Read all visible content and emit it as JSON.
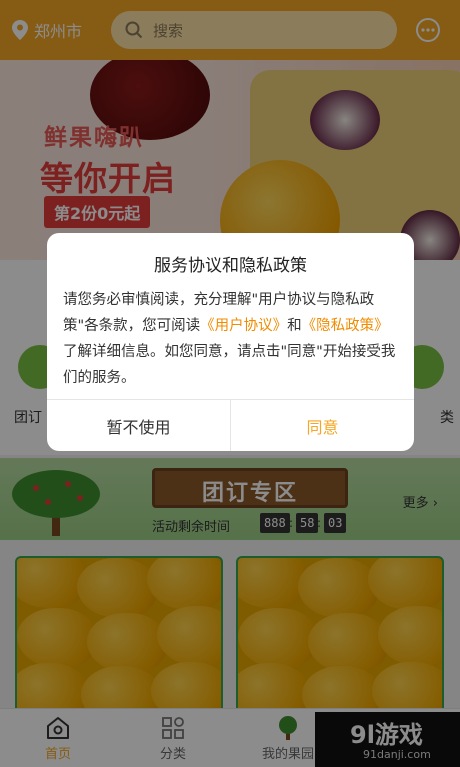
{
  "header": {
    "city": "郑州市",
    "search_placeholder": "搜索"
  },
  "banner": {
    "line1": "鲜果嗨趴",
    "line2": "等你开启",
    "promo": "第2份0元起"
  },
  "categories": {
    "left_label": "团订",
    "right_label": "类"
  },
  "group_zone": {
    "title": "团订专区",
    "countdown_label": "活动剩余时间",
    "countdown": [
      "888",
      "58",
      "03"
    ],
    "more": "更多"
  },
  "tabbar": {
    "tabs": [
      {
        "label": "首页"
      },
      {
        "label": "分类"
      },
      {
        "label": "我的果园"
      }
    ]
  },
  "watermark": {
    "brand": "9l游戏",
    "url": "91danji.com"
  },
  "dialog": {
    "title": "服务协议和隐私政策",
    "body_part1": "请您务必审慎阅读，充分理解\"用户协议与隐私政策\"各条款，您可阅读",
    "link_user": "《用户协议》",
    "body_and": "和",
    "link_privacy": "《隐私政策》",
    "body_part2": "了解详细信息。如您同意，请点击\"同意\"开始接受我们的服务。",
    "cancel": "暂不使用",
    "agree": "同意"
  },
  "colors": {
    "brand": "#f5a623",
    "link": "#f08c00",
    "green": "#35a853"
  }
}
